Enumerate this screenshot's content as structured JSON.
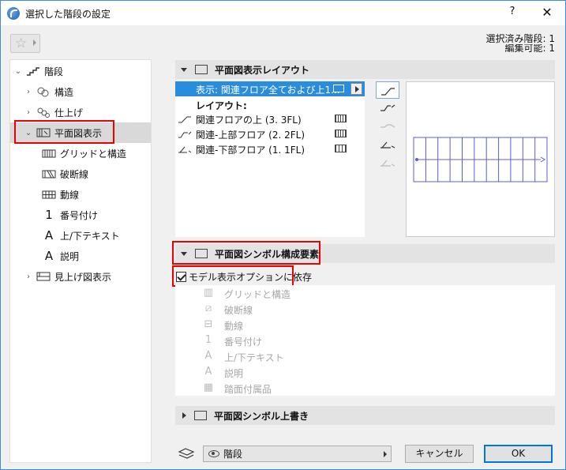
{
  "window": {
    "title": "選択した階段の設定",
    "help_label": "?",
    "close_label": "✕"
  },
  "info": {
    "selected_count": "選択済み階段: 1",
    "editable_count": "編集可能: 1"
  },
  "tree": {
    "items": [
      {
        "label": "階段",
        "icon": "stair-icon",
        "chevron": "⌄"
      },
      {
        "label": "構造",
        "icon": "structure-icon",
        "chevron": "›"
      },
      {
        "label": "仕上げ",
        "icon": "finish-icon",
        "chevron": "›"
      },
      {
        "label": "平面図表示",
        "icon": "floor-plan-icon",
        "chevron": "⌄"
      },
      {
        "label": "グリッドと構造",
        "icon": "grid-structure-icon"
      },
      {
        "label": "破断線",
        "icon": "break-line-icon"
      },
      {
        "label": "動線",
        "icon": "walking-line-icon"
      },
      {
        "label": "番号付け",
        "icon": "numbering-icon"
      },
      {
        "label": "上/下テキスト",
        "icon": "up-down-text-icon"
      },
      {
        "label": "説明",
        "icon": "description-icon"
      },
      {
        "label": "見上げ図表示",
        "icon": "reflected-view-icon",
        "chevron": "›"
      }
    ]
  },
  "plan_layout": {
    "header": "平面図表示レイアウト",
    "display_value": "表示: 関連フロア全ておよび上1...",
    "layout_label": "レイアウト:",
    "rows": [
      {
        "label": "関連フロアの上 (3. 3FL)"
      },
      {
        "label": "関連-上部フロア (2. 2FL)"
      },
      {
        "label": "関連-下部フロア (1. 1FL)"
      }
    ]
  },
  "symbol_components": {
    "header": "平面図シンボル構成要素",
    "checkbox_label": "モデル表示オプションに依存",
    "checked": true,
    "items": [
      {
        "label": "グリッドと構造",
        "glyph": "▥"
      },
      {
        "label": "破断線",
        "glyph": "⧄"
      },
      {
        "label": "動線",
        "glyph": "⊟"
      },
      {
        "label": "番号付け",
        "glyph": "1"
      },
      {
        "label": "上/下テキスト",
        "glyph": "A"
      },
      {
        "label": "説明",
        "glyph": "A"
      },
      {
        "label": "踏面付属品",
        "glyph": "▦"
      }
    ]
  },
  "override": {
    "header": "平面図シンボル上書き"
  },
  "footer": {
    "layer_value": "階段",
    "cancel_label": "キャンセル",
    "ok_label": "OK"
  },
  "colors": {
    "accent": "#2a8cdc",
    "highlight": "#ee0000",
    "preview_lines": "#5c5cd6"
  }
}
